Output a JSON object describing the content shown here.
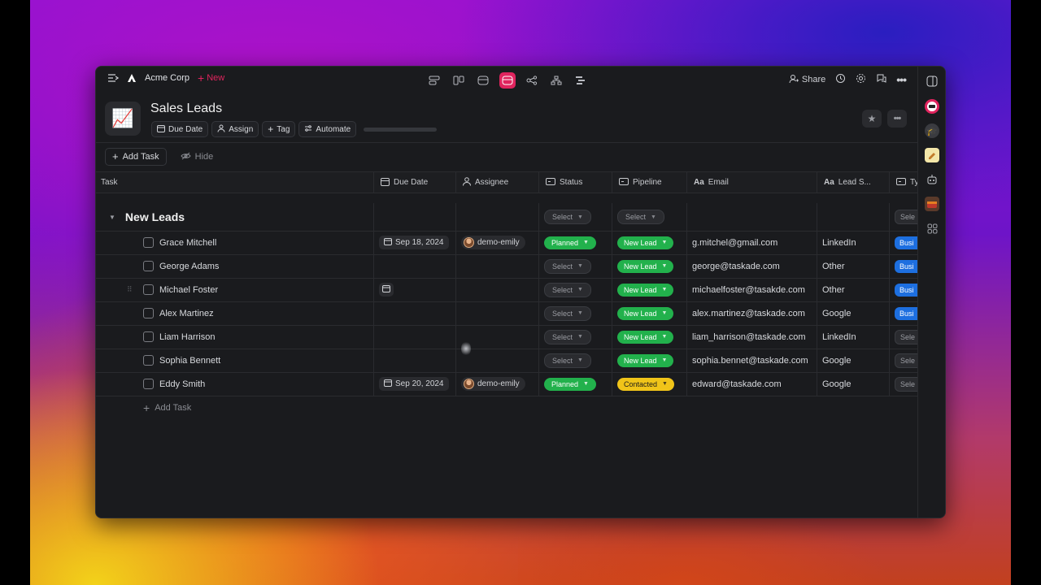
{
  "app": {
    "workspace": "Acme Corp",
    "new_label": "New",
    "share_label": "Share",
    "project_title": "Sales Leads",
    "project_emoji": "📈"
  },
  "header_chips": {
    "due_date": "Due Date",
    "assign": "Assign",
    "tag": "Tag",
    "automate": "Automate"
  },
  "toolbar": {
    "add_task": "Add Task",
    "hide": "Hide"
  },
  "columns": {
    "task": "Task",
    "due_date": "Due Date",
    "assignee": "Assignee",
    "status": "Status",
    "pipeline": "Pipeline",
    "email": "Email",
    "lead_source": "Lead S...",
    "type": "Ty"
  },
  "group": {
    "title": "New Leads",
    "status_placeholder": "Select",
    "pipeline_placeholder": "Select",
    "type_placeholder": "Sele"
  },
  "rows": [
    {
      "name": "Grace Mitchell",
      "due": "Sep 18, 2024",
      "assignee": "demo-emily",
      "status": "Planned",
      "pipeline": "New Lead",
      "email": "g.mitchel@gmail.com",
      "source": "LinkedIn",
      "type": "Busi"
    },
    {
      "name": "George Adams",
      "due": "",
      "assignee": "",
      "status": "Select",
      "pipeline": "New Lead",
      "email": "george@taskade.com",
      "source": "Other",
      "type": "Busi"
    },
    {
      "name": "Michael Foster",
      "due": "",
      "assignee": "",
      "status": "Select",
      "pipeline": "New Lead",
      "email": "michaelfoster@tasakde.com",
      "source": "Other",
      "type": "Busi"
    },
    {
      "name": "Alex Martinez",
      "due": "",
      "assignee": "",
      "status": "Select",
      "pipeline": "New Lead",
      "email": "alex.martinez@taskade.com",
      "source": "Google",
      "type": "Busi"
    },
    {
      "name": "Liam Harrison",
      "due": "",
      "assignee": "",
      "status": "Select",
      "pipeline": "New Lead",
      "email": "liam_harrison@taskade.com",
      "source": "LinkedIn",
      "type": "Sele"
    },
    {
      "name": "Sophia Bennett",
      "due": "",
      "assignee": "",
      "status": "Select",
      "pipeline": "New Lead",
      "email": "sophia.bennet@taskade.com",
      "source": "Google",
      "type": "Sele"
    },
    {
      "name": "Eddy Smith",
      "due": "Sep 20, 2024",
      "assignee": "demo-emily",
      "status": "Planned",
      "pipeline": "Contacted",
      "email": "edward@taskade.com",
      "source": "Google",
      "type": "Sele"
    }
  ],
  "add_task_footer": "Add Task",
  "colors": {
    "accent": "#e0245e",
    "planned": "#22b14c",
    "new_lead": "#22b14c",
    "contacted": "#f0c419",
    "business": "#1d6fe0"
  }
}
